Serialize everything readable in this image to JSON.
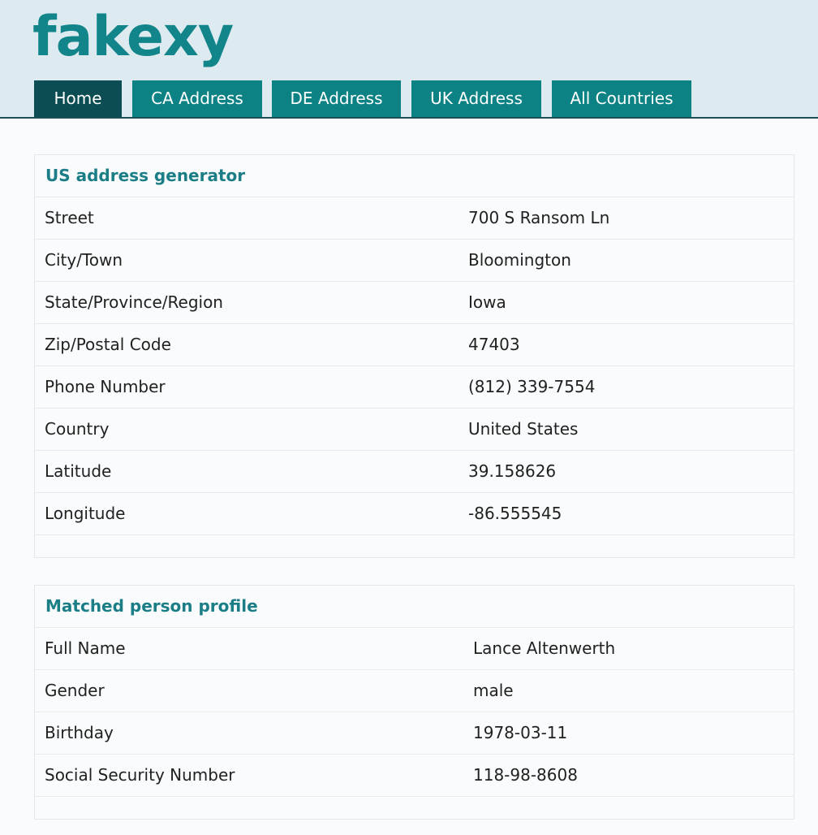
{
  "site": {
    "logo": "fakexy"
  },
  "nav": {
    "tabs": [
      {
        "label": "Home",
        "active": true
      },
      {
        "label": "CA Address",
        "active": false
      },
      {
        "label": "DE Address",
        "active": false
      },
      {
        "label": "UK Address",
        "active": false
      },
      {
        "label": "All Countries",
        "active": false
      }
    ]
  },
  "address_card": {
    "title": "US address generator",
    "rows": [
      {
        "label": "Street",
        "value": "700 S Ransom Ln"
      },
      {
        "label": "City/Town",
        "value": "Bloomington"
      },
      {
        "label": "State/Province/Region",
        "value": "Iowa"
      },
      {
        "label": "Zip/Postal Code",
        "value": "47403"
      },
      {
        "label": "Phone Number",
        "value": "(812) 339-7554"
      },
      {
        "label": "Country",
        "value": "United States"
      },
      {
        "label": "Latitude",
        "value": "39.158626"
      },
      {
        "label": "Longitude",
        "value": "-86.555545"
      }
    ]
  },
  "person_card": {
    "title": "Matched person profile",
    "rows": [
      {
        "label": "Full Name",
        "value": "Lance Altenwerth"
      },
      {
        "label": "Gender",
        "value": "male"
      },
      {
        "label": "Birthday",
        "value": "1978-03-11"
      },
      {
        "label": "Social Security Number",
        "value": "118-98-8608"
      }
    ]
  },
  "colors": {
    "brand": "#12858a",
    "tab": "#0c8285",
    "tab_active": "#0b4d52",
    "header_bg": "#ddeaf0"
  }
}
